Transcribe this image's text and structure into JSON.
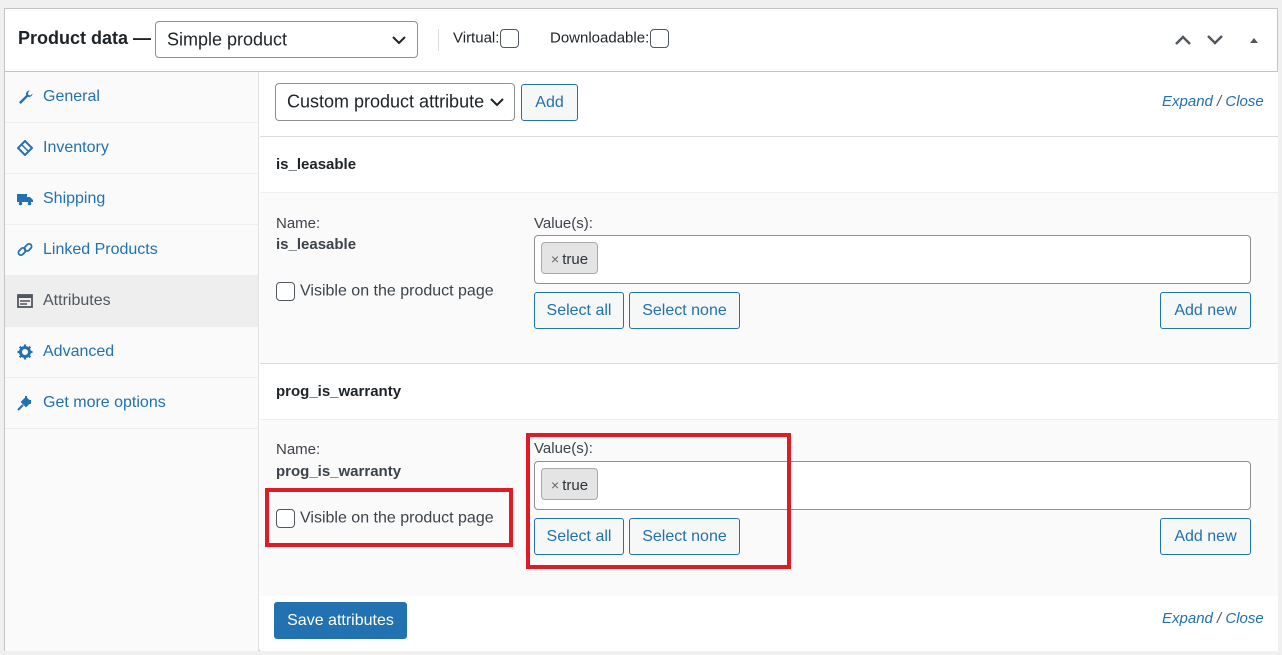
{
  "header": {
    "title": "Product data —",
    "product_type": "Simple product",
    "virtual_label": "Virtual:",
    "downloadable_label": "Downloadable:"
  },
  "sidebar": {
    "items": [
      {
        "label": "General",
        "icon": "wrench-icon"
      },
      {
        "label": "Inventory",
        "icon": "tag-icon"
      },
      {
        "label": "Shipping",
        "icon": "truck-icon"
      },
      {
        "label": "Linked Products",
        "icon": "link-icon"
      },
      {
        "label": "Attributes",
        "icon": "list-icon",
        "active": true
      },
      {
        "label": "Advanced",
        "icon": "gear-icon"
      },
      {
        "label": "Get more options",
        "icon": "plugin-icon"
      }
    ]
  },
  "toolbar": {
    "attribute_select": "Custom product attribute",
    "add_label": "Add",
    "expand": "Expand",
    "slash": "/",
    "close": "Close"
  },
  "attributes": [
    {
      "heading": "is_leasable",
      "name_label": "Name:",
      "name_value": "is_leasable",
      "visible_label": "Visible on the product page",
      "values_label": "Value(s):",
      "token_x": "×",
      "token": "true",
      "select_all": "Select all",
      "select_none": "Select none",
      "add_new": "Add new"
    },
    {
      "heading": "prog_is_warranty",
      "name_label": "Name:",
      "name_value": "prog_is_warranty",
      "visible_label": "Visible on the product page",
      "values_label": "Value(s):",
      "token_x": "×",
      "token": "true",
      "select_all": "Select all",
      "select_none": "Select none",
      "add_new": "Add new"
    }
  ],
  "footer": {
    "save_label": "Save attributes",
    "expand": "Expand",
    "slash": "/",
    "close": "Close"
  },
  "colors": {
    "accent": "#2271b1",
    "highlight": "#dd1c26"
  }
}
